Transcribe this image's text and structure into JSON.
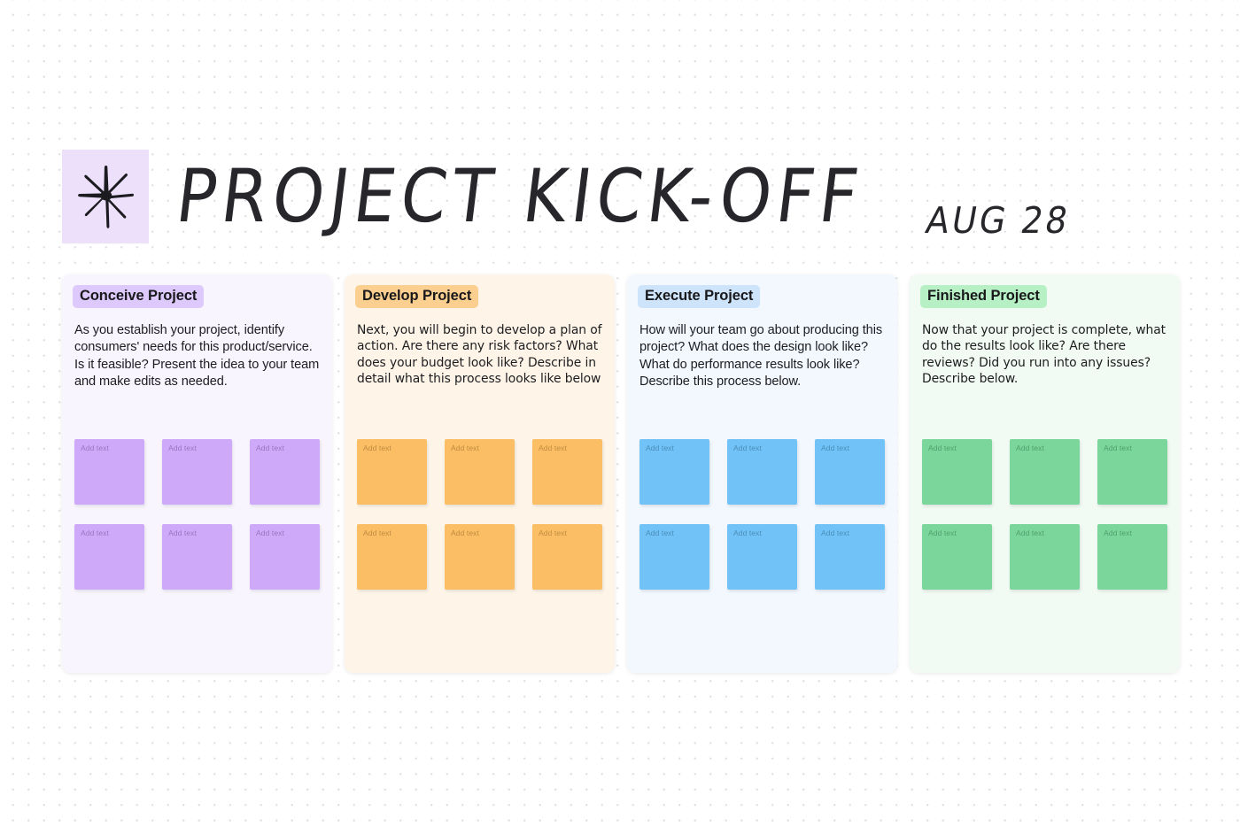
{
  "header": {
    "logo_icon": "sparkle-star-icon",
    "logo_tile_color": "#ece0fb",
    "title": "PROJECT KICK-OFF",
    "date": "AUG 28"
  },
  "note_placeholder": "Add text",
  "columns": [
    {
      "id": "conceive",
      "heading": "Conceive Project",
      "description": "As you establish your project, identify consumers' needs for this product/service. Is it feasible? Present the idea to your team and make edits as needed.",
      "panel_color": "#f9f5fe",
      "heading_chip_color": "#ddc9fb",
      "note_color": "#cfa9f9",
      "note_text_color": "#6a4a93",
      "notes": [
        {
          "text": "Add text"
        },
        {
          "text": "Add text"
        },
        {
          "text": "Add text"
        },
        {
          "text": "Add text"
        },
        {
          "text": "Add text"
        },
        {
          "text": "Add text"
        }
      ]
    },
    {
      "id": "develop",
      "heading": "Develop Project",
      "description": "Next, you will begin to develop a plan of action. Are there any risk factors? What does your budget look like? Describe in detail what this process looks like below",
      "panel_color": "#fef5e8",
      "heading_chip_color": "#fbcf8f",
      "note_color": "#fbbe64",
      "note_text_color": "#8d6223",
      "notes": [
        {
          "text": "Add text"
        },
        {
          "text": "Add text"
        },
        {
          "text": "Add text"
        },
        {
          "text": "Add text"
        },
        {
          "text": "Add text"
        },
        {
          "text": "Add text"
        }
      ]
    },
    {
      "id": "execute",
      "heading": "Execute Project",
      "description": "How will your team go about producing this project? What does the design look like? What do performance results look like? Describe this process below.",
      "panel_color": "#f2f8fe",
      "heading_chip_color": "#cde4fa",
      "note_color": "#70c2f7",
      "note_text_color": "#2d6287",
      "notes": [
        {
          "text": "Add text"
        },
        {
          "text": "Add text"
        },
        {
          "text": "Add text"
        },
        {
          "text": "Add text"
        },
        {
          "text": "Add text"
        },
        {
          "text": "Add text"
        }
      ]
    },
    {
      "id": "finished",
      "heading": "Finished Project",
      "description": "Now that your project is complete, what do the results look like? Are there reviews? Did you run into any issues? Describe below.",
      "panel_color": "#f1fbf3",
      "heading_chip_color": "#b7f0c4",
      "note_color": "#7ad69a",
      "note_text_color": "#2f7349",
      "notes": [
        {
          "text": "Add text"
        },
        {
          "text": "Add text"
        },
        {
          "text": "Add text"
        },
        {
          "text": "Add text"
        },
        {
          "text": "Add text"
        },
        {
          "text": "Add text"
        }
      ]
    }
  ]
}
